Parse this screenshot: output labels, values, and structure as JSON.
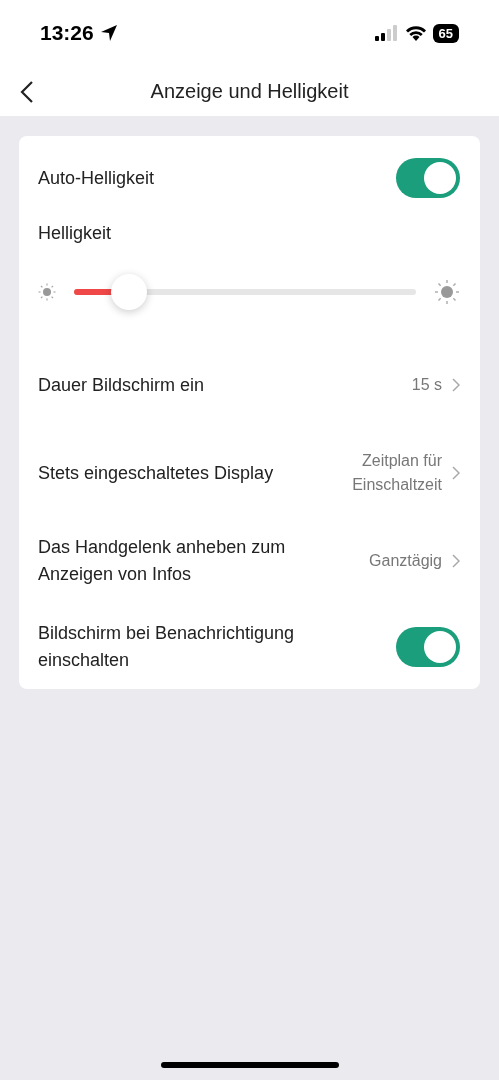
{
  "status_bar": {
    "time": "13:26",
    "battery": "65"
  },
  "header": {
    "title": "Anzeige und Helligkeit"
  },
  "settings": [
    {
      "kind": "toggle",
      "label": "Auto-Helligkeit",
      "on": true
    },
    {
      "kind": "slider",
      "label": "Helligkeit",
      "level": 0.16
    },
    {
      "kind": "nav",
      "label": "Dauer Bildschirm ein",
      "value": "15 s"
    },
    {
      "kind": "nav",
      "label": "Stets eingeschaltetes Display",
      "value": "Zeitplan für Einschaltzeit"
    },
    {
      "kind": "nav",
      "label": "Das Handgelenk anheben zum Anzeigen von Infos",
      "value": "Ganztägig"
    },
    {
      "kind": "toggle",
      "label": "Bildschirm bei Benachrichtigung einschalten",
      "on": true
    }
  ]
}
